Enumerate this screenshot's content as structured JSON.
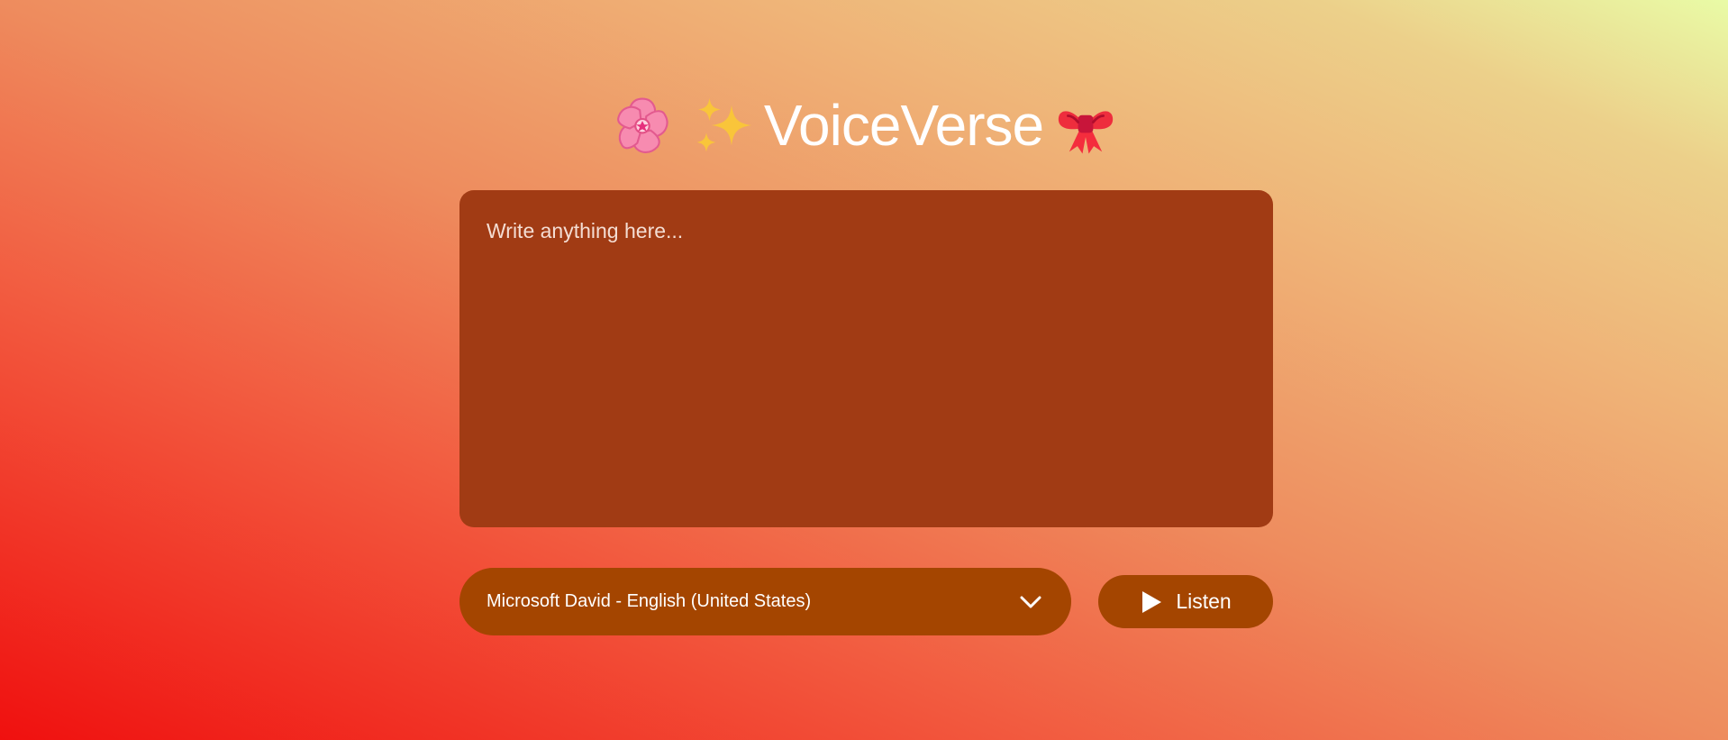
{
  "header": {
    "title": "VoiceVerse",
    "left_icons": [
      "cherry-blossom-icon",
      "sparkles-icon"
    ],
    "right_icons": [
      "ribbon-icon"
    ]
  },
  "editor": {
    "placeholder": "Write anything here...",
    "value": ""
  },
  "voice_select": {
    "selected": "Microsoft David - English (United States)",
    "icon": "chevron-down-icon"
  },
  "listen_button": {
    "label": "Listen",
    "icon": "play-icon"
  },
  "colors": {
    "gradient_bottom_left": "#f0100f",
    "gradient_top_right": "#e9fba6",
    "textarea_background": "#a13b14",
    "control_background": "#a44500",
    "text": "#ffffff"
  }
}
